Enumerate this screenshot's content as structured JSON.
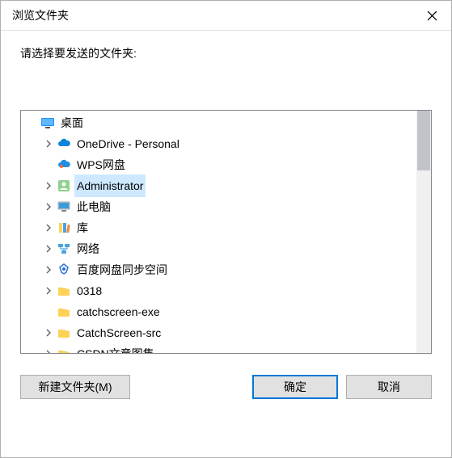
{
  "window": {
    "title": "浏览文件夹"
  },
  "prompt": "请选择要发送的文件夹:",
  "tree": {
    "root_label": "桌面",
    "items": [
      {
        "label": "OneDrive - Personal",
        "icon": "onedrive",
        "expander": true,
        "selected": false
      },
      {
        "label": "WPS网盘",
        "icon": "wps",
        "expander": false,
        "selected": false
      },
      {
        "label": "Administrator",
        "icon": "user",
        "expander": true,
        "selected": true
      },
      {
        "label": "此电脑",
        "icon": "thispc",
        "expander": true,
        "selected": false
      },
      {
        "label": "库",
        "icon": "libraries",
        "expander": true,
        "selected": false
      },
      {
        "label": "网络",
        "icon": "network",
        "expander": true,
        "selected": false
      },
      {
        "label": "百度网盘同步空间",
        "icon": "baidu",
        "expander": true,
        "selected": false
      },
      {
        "label": "0318",
        "icon": "folder",
        "expander": true,
        "selected": false
      },
      {
        "label": "catchscreen-exe",
        "icon": "folder",
        "expander": false,
        "selected": false
      },
      {
        "label": "CatchScreen-src",
        "icon": "folder",
        "expander": true,
        "selected": false
      },
      {
        "label": "CSDN文章图集",
        "icon": "folder",
        "expander": true,
        "selected": false
      }
    ]
  },
  "buttons": {
    "new_folder": "新建文件夹(M)",
    "ok": "确定",
    "cancel": "取消"
  },
  "icons": {
    "close": "close-icon",
    "chevron": "chevron-right-icon"
  }
}
